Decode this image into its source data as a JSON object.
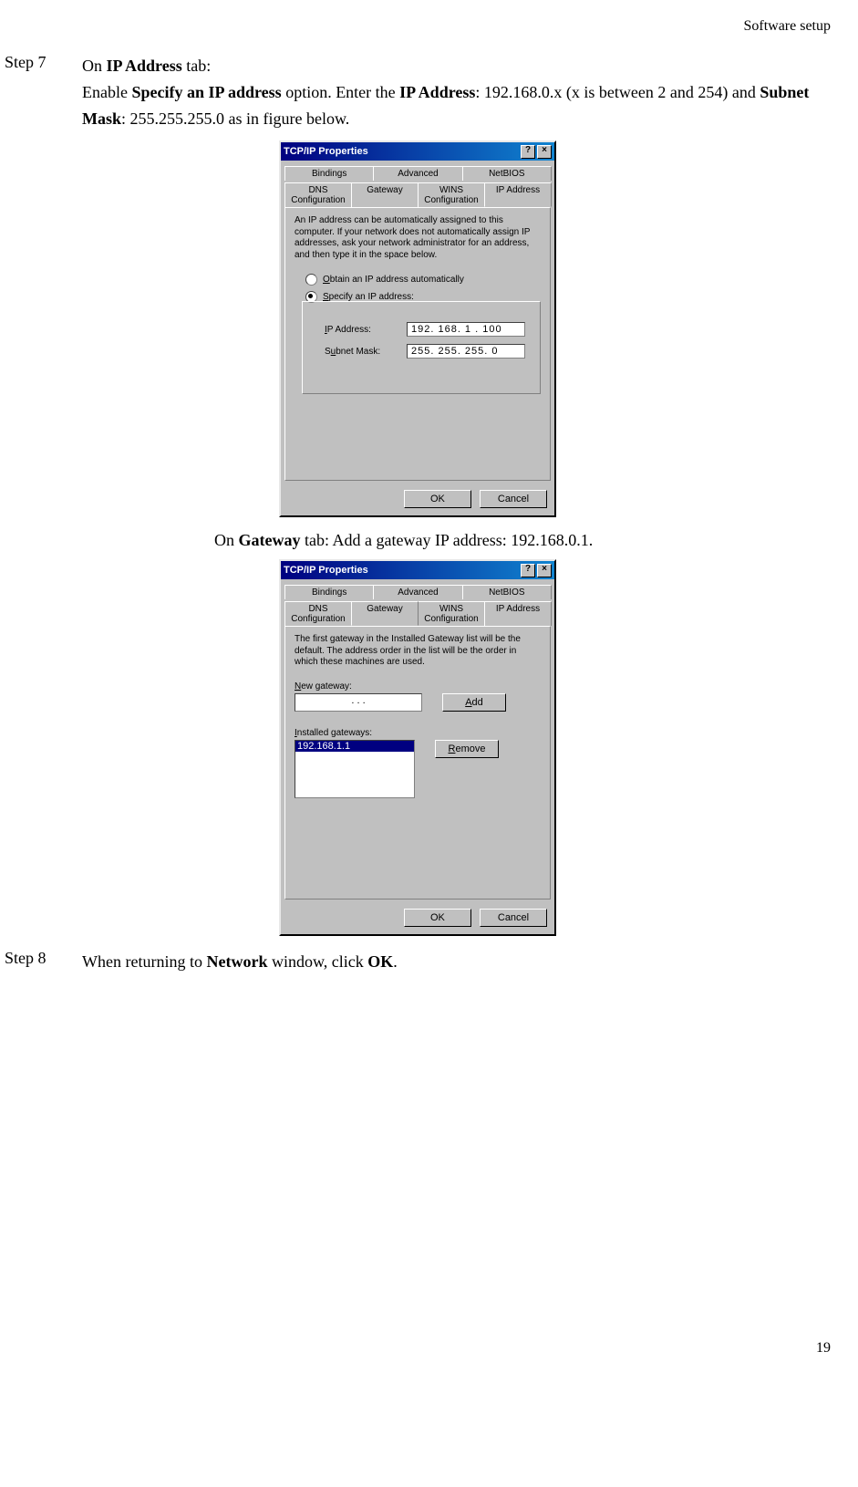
{
  "header": {
    "section": "Software  setup"
  },
  "step7": {
    "label": "Step 7",
    "line1_pre": "On ",
    "line1_b": "IP Address",
    "line1_post": " tab:",
    "line2_a": "Enable ",
    "line2_b1": "Specify an IP address",
    "line2_c": " option. Enter the ",
    "line2_b2": "IP Address",
    "line2_d": ": 192.168.0.x (x is between 2 and 254) and ",
    "line2_b3": "Subnet Mask",
    "line2_e": ": 255.255.255.0 as in figure below."
  },
  "dialog1": {
    "title": "TCP/IP Properties",
    "tabs_back": [
      "Bindings",
      "Advanced",
      "NetBIOS"
    ],
    "tabs_front": [
      "DNS Configuration",
      "Gateway",
      "WINS Configuration",
      "IP Address"
    ],
    "active_tab": "IP Address",
    "help": "An IP address can be automatically assigned to this computer. If your network does not automatically assign IP addresses, ask your network administrator for an address, and then type it in the space below.",
    "radio_auto": "Obtain an IP address automatically",
    "radio_spec": "Specify an IP address:",
    "ip_label": "IP Address:",
    "ip_value": "192. 168.  1  . 100",
    "mask_label": "Subnet Mask:",
    "mask_value": "255. 255. 255.  0",
    "ok": "OK",
    "cancel": "Cancel",
    "help_btn": "?",
    "close_btn": "×"
  },
  "caption": {
    "pre": "On ",
    "b": "Gateway",
    "post": " tab: Add a gateway IP address: 192.168.0.1."
  },
  "dialog2": {
    "title": "TCP/IP Properties",
    "tabs_back": [
      "Bindings",
      "Advanced",
      "NetBIOS"
    ],
    "tabs_front": [
      "DNS Configuration",
      "Gateway",
      "WINS Configuration",
      "IP Address"
    ],
    "active_tab": "Gateway",
    "help": "The first gateway in the Installed Gateway list will be the default. The address order in the list will be the order in which these machines are used.",
    "new_gw_label": "New gateway:",
    "new_gw_value": ".     .     .",
    "add": "Add",
    "installed_label": "Installed gateways:",
    "installed_item": "192.168.1.1",
    "remove": "Remove",
    "ok": "OK",
    "cancel": "Cancel",
    "help_btn": "?",
    "close_btn": "×"
  },
  "step8": {
    "label": "Step 8",
    "text_a": "When returning to ",
    "text_b": "Network",
    "text_c": " window, click ",
    "text_d": "OK",
    "text_e": "."
  },
  "page_number": "19"
}
